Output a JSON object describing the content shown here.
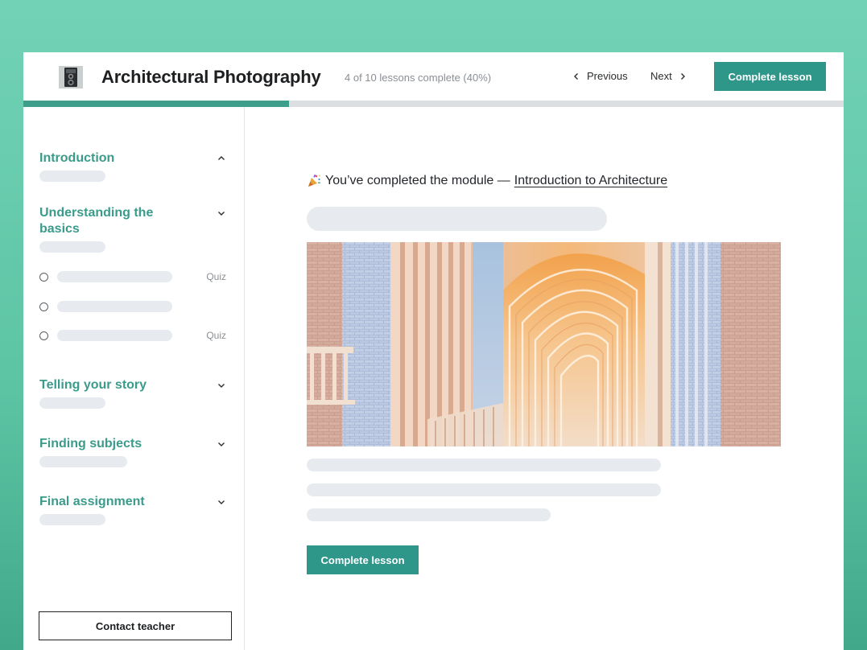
{
  "header": {
    "logo_icon": "camera-icon",
    "course_title": "Architectural Photography",
    "progress_text": "4 of 10 lessons complete (40%)",
    "progress_fraction": 0.4,
    "previous_label": "Previous",
    "next_label": "Next",
    "complete_label": "Complete lesson"
  },
  "sidebar": {
    "modules": [
      {
        "title": "Introduction",
        "chevron": "chevron-up-icon"
      },
      {
        "title": "Understanding the basics",
        "chevron": "chevron-down-icon"
      },
      {
        "title": "Telling your story",
        "chevron": "chevron-down-icon"
      },
      {
        "title": "Finding subjects",
        "chevron": "chevron-down-icon"
      },
      {
        "title": "Final assignment",
        "chevron": "chevron-down-icon"
      }
    ],
    "lessons": [
      {
        "tag": "Quiz"
      },
      {
        "tag": ""
      },
      {
        "tag": "Quiz"
      }
    ],
    "contact_label": "Contact teacher"
  },
  "main": {
    "completed_prefix": "You’ve completed the module —",
    "module_link": "Introduction to Architecture",
    "party_icon": "party-popper-icon",
    "complete_label": "Complete lesson"
  },
  "colors": {
    "accent": "#2f968a",
    "module_title": "#3a9b8b",
    "background_top": "#72d2b6",
    "background_bottom": "#42a88a",
    "skeleton": "#e7ebf0"
  }
}
